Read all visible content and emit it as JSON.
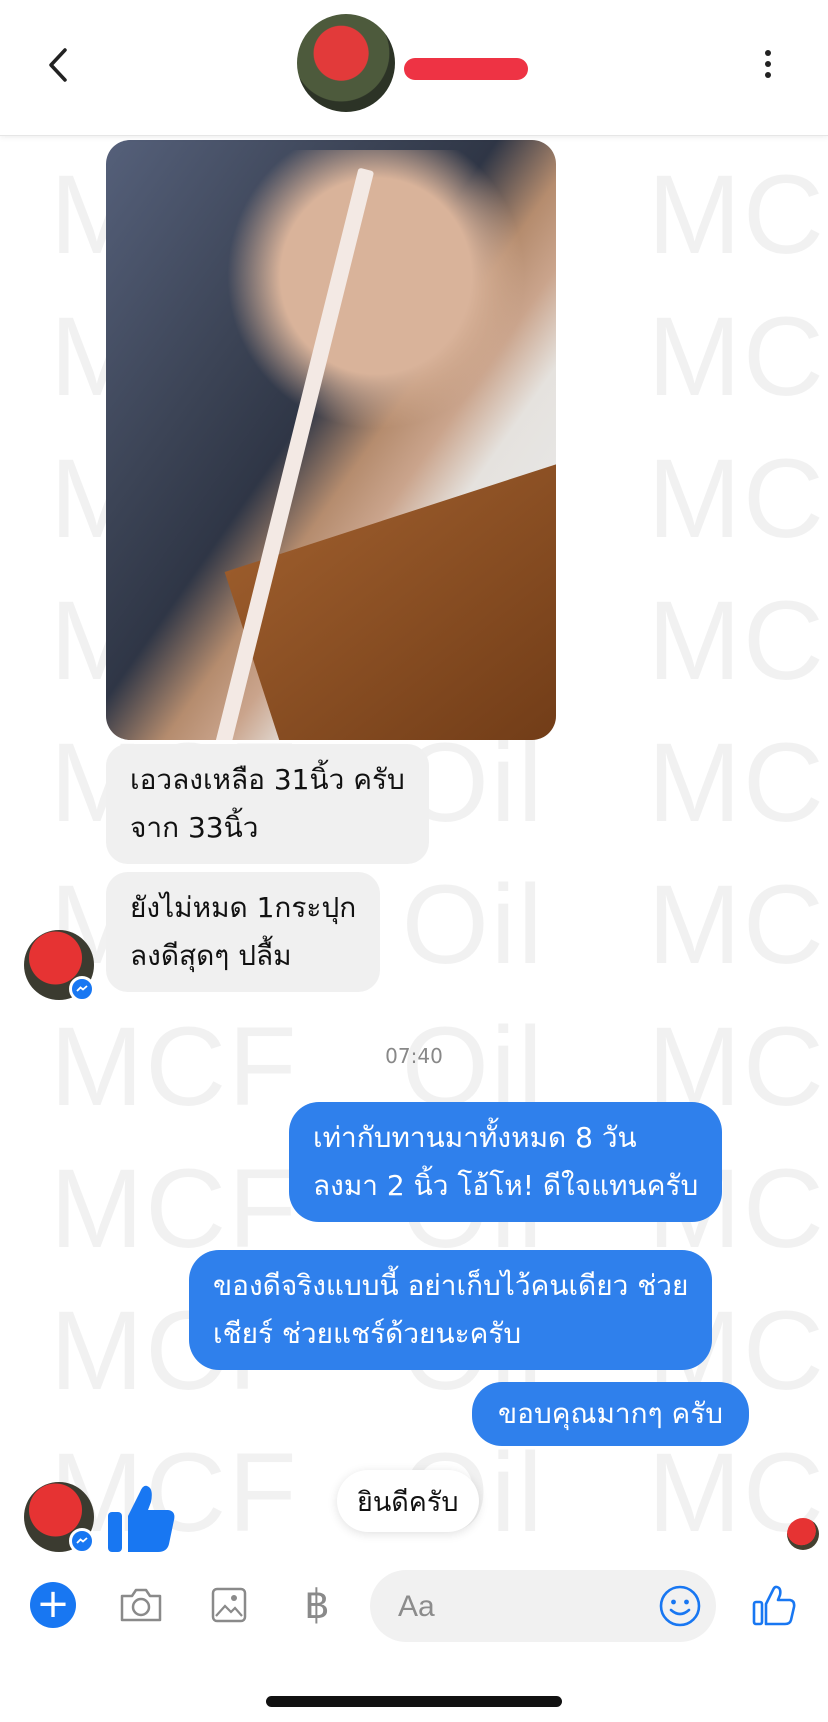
{
  "header": {
    "back_icon": "chevron-left-icon",
    "more_icon": "vertical-ellipsis-icon"
  },
  "watermark": {
    "text": "MCF Oil MCF Oil"
  },
  "messages": {
    "incoming": [
      {
        "lines": [
          "เอวลงเหลือ 31นิ้ว ครับ",
          "จาก 33นิ้ว"
        ]
      },
      {
        "lines": [
          "ยังไม่หมด 1กระปุก",
          "ลงดีสุดๆ  ปลื้ม"
        ]
      }
    ],
    "timestamp": "07:40",
    "outgoing": [
      {
        "lines": [
          "เท่ากับทานมาทั้งหมด 8 วัน",
          "ลงมา 2 นิ้ว โอ้โห!  ดีใจแทนครับ"
        ]
      },
      {
        "lines": [
          "ของดีจริงแบบนี้ อย่าเก็บไว้คนเดียว ช่วย",
          "เชียร์ ช่วยแชร์ด้วยนะครับ"
        ]
      },
      {
        "lines": [
          "ขอบคุณมากๆ ครับ"
        ]
      }
    ],
    "last_incoming_icon": "thumbs-up-icon"
  },
  "quick_reply": {
    "label": "ยินดีครับ"
  },
  "composer": {
    "placeholder": "Aa",
    "baht_symbol": "฿",
    "icons": [
      "plus-icon",
      "camera-icon",
      "image-icon",
      "baht-icon",
      "emoji-icon",
      "thumbs-up-icon"
    ],
    "accent_color": "#1877f2",
    "outgoing_bubble_color": "#2f80ec"
  }
}
